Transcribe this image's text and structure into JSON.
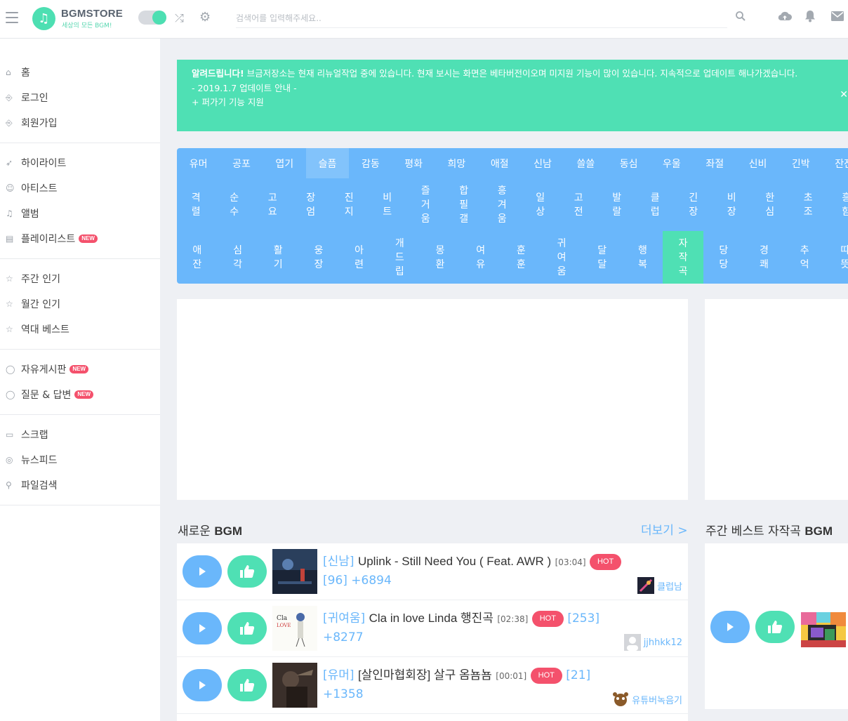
{
  "header": {
    "logo_name": "BGMSTORE",
    "logo_sub": "세상의 모든 BGM!",
    "search_placeholder": "검색어를 입력해주세요.."
  },
  "sidebar": {
    "groups": [
      [
        {
          "label": "홈",
          "icon": "home-icon"
        },
        {
          "label": "로그인",
          "icon": "login-icon"
        },
        {
          "label": "회원가입",
          "icon": "signup-icon"
        }
      ],
      [
        {
          "label": "하이라이트",
          "icon": "rocket-icon"
        },
        {
          "label": "아티스트",
          "icon": "user-icon"
        },
        {
          "label": "앨범",
          "icon": "music-note-icon"
        },
        {
          "label": "플레이리스트",
          "icon": "playlist-icon",
          "badge": "NEW"
        }
      ],
      [
        {
          "label": "주간 인기",
          "icon": "star-icon"
        },
        {
          "label": "월간 인기",
          "icon": "star-icon"
        },
        {
          "label": "역대 베스트",
          "icon": "star-icon"
        }
      ],
      [
        {
          "label": "자유게시판",
          "icon": "chat-icon",
          "badge": "NEW"
        },
        {
          "label": "질문 & 답변",
          "icon": "chat-icon",
          "badge": "NEW"
        }
      ],
      [
        {
          "label": "스크랩",
          "icon": "inbox-icon"
        },
        {
          "label": "뉴스피드",
          "icon": "globe-icon"
        },
        {
          "label": "파일검색",
          "icon": "search-icon"
        }
      ]
    ]
  },
  "notice": {
    "title": "알려드립니다!",
    "body": " 브금저장소는 현재 리뉴얼작업 중에 있습니다. 현재 보시는 화면은 베타버전이오며 미지원 기능이 많이 있습니다. 지속적으로 업데이트 해나가겠습니다.",
    "line2": "- 2019.1.7 업데이트 안내 -",
    "line3": "+ 퍼가기 기능 지원"
  },
  "categories": {
    "row1": [
      "유머",
      "공포",
      "엽기",
      "슬픔",
      "감동",
      "평화",
      "희망",
      "애절",
      "신남",
      "쓸쓸",
      "동심",
      "우울",
      "좌절",
      "신비",
      "긴박",
      "잔잔"
    ],
    "row1_active_index": 3,
    "row2": [
      "격렬",
      "순수",
      "고요",
      "장엄",
      "진지",
      "비트",
      "즐거움",
      "합필갤",
      "흥겨움",
      "일상",
      "고전",
      "발랄",
      "클럽",
      "긴장",
      "비장",
      "한심",
      "초조",
      "흥함"
    ],
    "row3": [
      "애잔",
      "심각",
      "활기",
      "웅장",
      "아련",
      "개드립",
      "몽환",
      "여유",
      "훈훈",
      "귀여움",
      "달달",
      "행복",
      "자작곡",
      "당당",
      "경쾌",
      "추억",
      "따뜻"
    ],
    "row3_selected_index": 12
  },
  "new_bgm": {
    "title": "새로운",
    "title_bold": "BGM",
    "more": "더보기 >",
    "tracks": [
      {
        "category": "[신남]",
        "title": "Uplink - Still Need You ( Feat. AWR )",
        "duration": "[03:04]",
        "hot": "HOT",
        "stats": "[96] +6894",
        "uploader": "클럽남"
      },
      {
        "category": "[귀여움]",
        "title": "Cla in love Linda 행진곡",
        "duration": "[02:38]",
        "hot": "HOT",
        "stats": "[253] +8277",
        "uploader": "jjhhkk12"
      },
      {
        "category": "[유머]",
        "title": "[살인마협회장] 살구 옴뇸뇸",
        "duration": "[00:01]",
        "hot": "HOT",
        "stats": "[21] +1358",
        "uploader": "유튜버녹음기"
      }
    ]
  },
  "weekly": {
    "title": "주간 베스트 자작곡",
    "title_bold": "BGM"
  },
  "colors": {
    "mint": "#4fe0b4",
    "blue": "#6ab7fb",
    "hot": "#f4516c"
  }
}
